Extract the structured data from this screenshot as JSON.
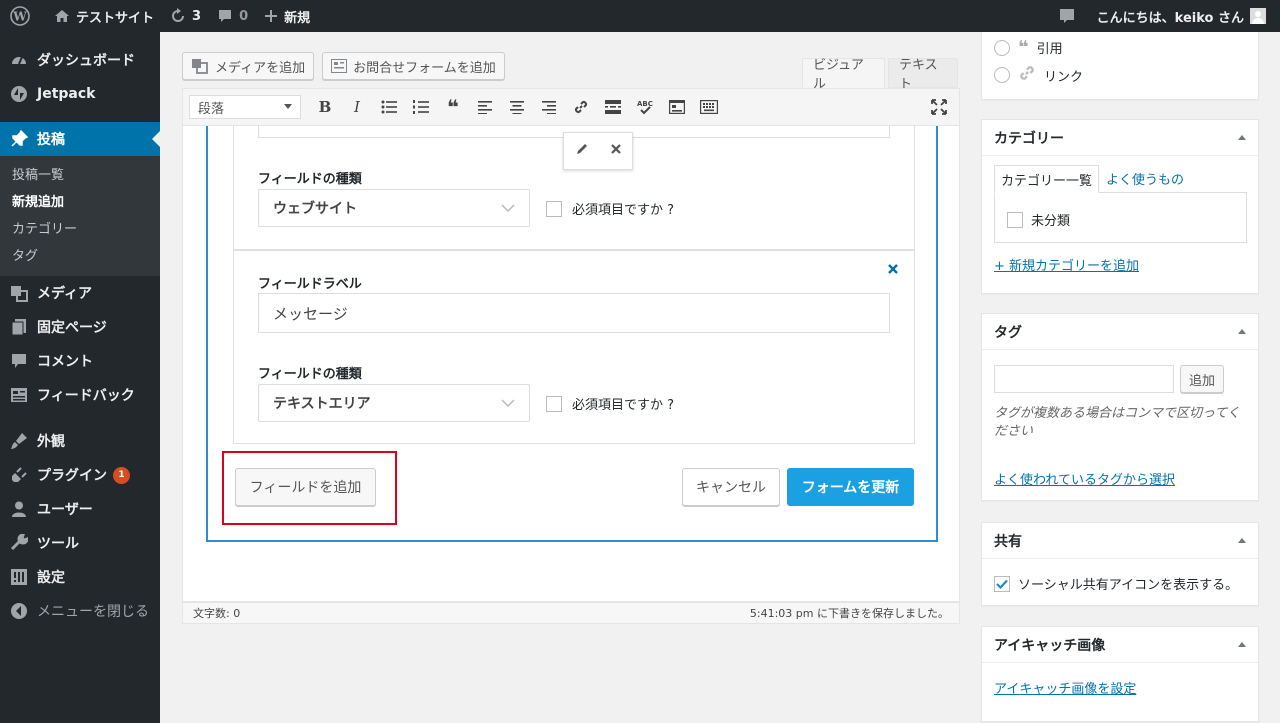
{
  "adminbar": {
    "site_name": "テストサイト",
    "updates_count": "3",
    "comments_count": "0",
    "new_label": "新規",
    "greeting": "こんにちは、keiko さん"
  },
  "sidebar": {
    "items": [
      {
        "label": "ダッシュボード",
        "icon": "dashboard-icon"
      },
      {
        "label": "Jetpack",
        "icon": "jetpack-icon"
      },
      {
        "label": "投稿",
        "icon": "pin-icon"
      },
      {
        "label": "メディア",
        "icon": "media-icon"
      },
      {
        "label": "固定ページ",
        "icon": "page-icon"
      },
      {
        "label": "コメント",
        "icon": "comment-icon"
      },
      {
        "label": "フィードバック",
        "icon": "feedback-icon"
      },
      {
        "label": "外観",
        "icon": "appearance-icon"
      },
      {
        "label": "プラグイン",
        "icon": "plugin-icon",
        "badge": "1"
      },
      {
        "label": "ユーザー",
        "icon": "user-icon"
      },
      {
        "label": "ツール",
        "icon": "tools-icon"
      },
      {
        "label": "設定",
        "icon": "settings-icon"
      },
      {
        "label": "メニューを閉じる",
        "icon": "collapse-icon"
      }
    ],
    "submenu": [
      "投稿一覧",
      "新規追加",
      "カテゴリー",
      "タグ"
    ]
  },
  "editor": {
    "add_media": "メディアを追加",
    "add_contact_form": "お問合せフォームを追加",
    "tab_visual": "ビジュアル",
    "tab_text": "テキスト",
    "format_select": "段落",
    "word_count": "文字数: 0",
    "autosave": "5:41:03 pm に下書きを保存しました。"
  },
  "form": {
    "field1_type_label": "フィールドの種類",
    "field1_type_value": "ウェブサイト",
    "field1_required": "必須項目ですか ?",
    "field2_label_label": "フィールドラベル",
    "field2_label_value": "メッセージ",
    "field2_type_label": "フィールドの種類",
    "field2_type_value": "テキストエリア",
    "field2_required": "必須項目ですか ?",
    "add_field": "フィールドを追加",
    "cancel": "キャンセル",
    "update": "フォームを更新"
  },
  "formats_box": {
    "quote": "引用",
    "link": "リンク"
  },
  "category_box": {
    "title": "カテゴリー",
    "tab_all": "カテゴリー一覧",
    "tab_popular": "よく使うもの",
    "uncategorized": "未分類",
    "add_new": "+ 新規カテゴリーを追加"
  },
  "tag_box": {
    "title": "タグ",
    "add_button": "追加",
    "hint": "タグが複数ある場合はコンマで区切ってください",
    "choose_popular": "よく使われているタグから選択"
  },
  "share_box": {
    "title": "共有",
    "show_icons": "ソーシャル共有アイコンを表示する。"
  },
  "thumbnail_box": {
    "title": "アイキャッチ画像",
    "set_link": "アイキャッチ画像を設定"
  }
}
